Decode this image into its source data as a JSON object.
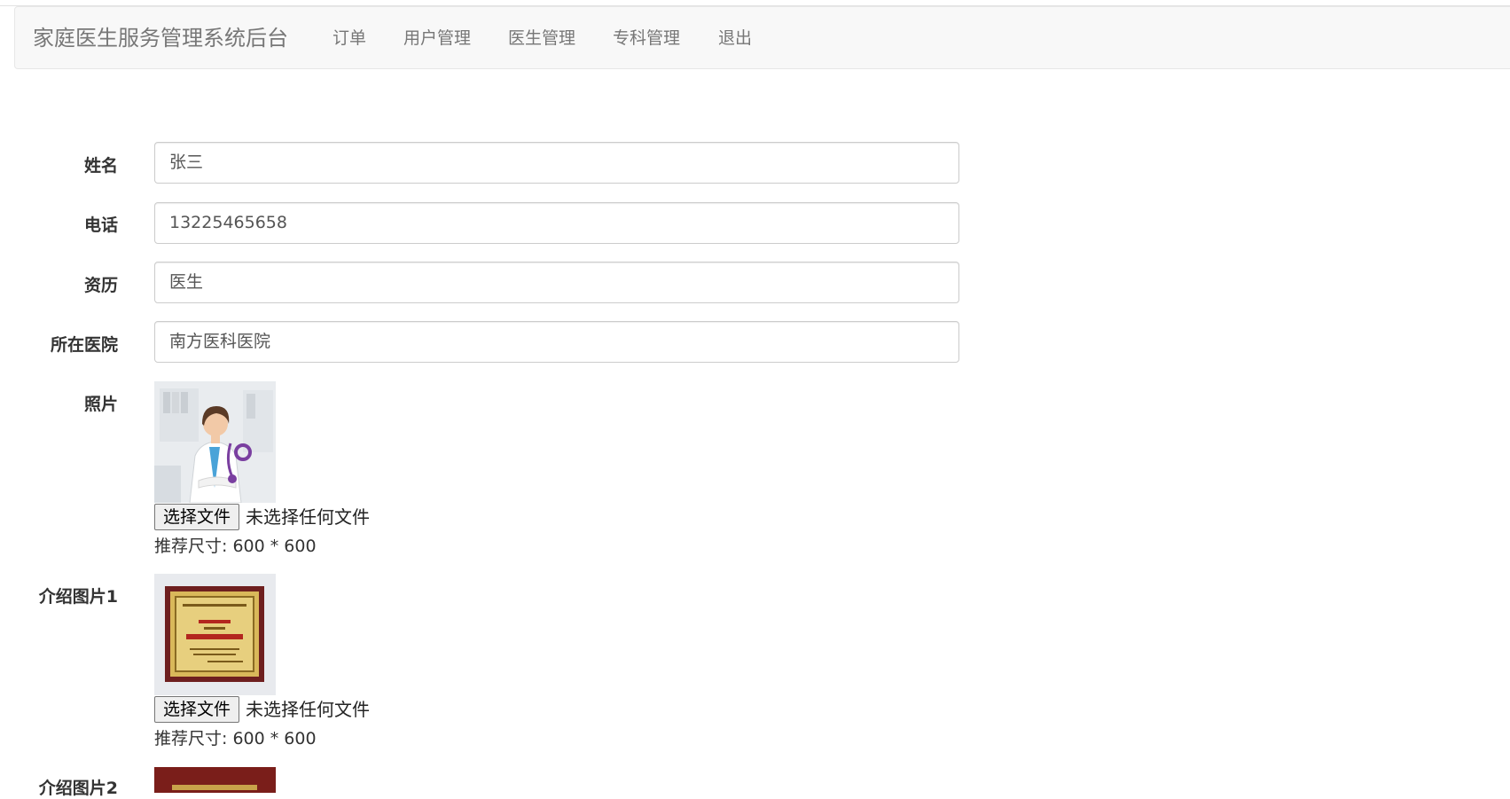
{
  "navbar": {
    "brand": "家庭医生服务管理系统后台",
    "items": [
      {
        "label": "订单"
      },
      {
        "label": "用户管理"
      },
      {
        "label": "医生管理"
      },
      {
        "label": "专科管理"
      },
      {
        "label": "退出"
      }
    ]
  },
  "form": {
    "name": {
      "label": "姓名",
      "value": "张三"
    },
    "phone": {
      "label": "电话",
      "value": "13225465658"
    },
    "qualification": {
      "label": "资历",
      "value": "医生"
    },
    "hospital": {
      "label": "所在医院",
      "value": "南方医科医院"
    },
    "photo": {
      "label": "照片",
      "choose_button": "选择文件",
      "file_status": "未选择任何文件",
      "size_hint": "推荐尺寸: 600 * 600"
    },
    "intro_image_1": {
      "label": "介绍图片1",
      "choose_button": "选择文件",
      "file_status": "未选择任何文件",
      "size_hint": "推荐尺寸: 600 * 600"
    },
    "intro_image_2": {
      "label": "介绍图片2"
    }
  },
  "colors": {
    "navbar_bg": "#f8f8f8",
    "nav_text": "#777777",
    "input_border": "#cccccc"
  }
}
